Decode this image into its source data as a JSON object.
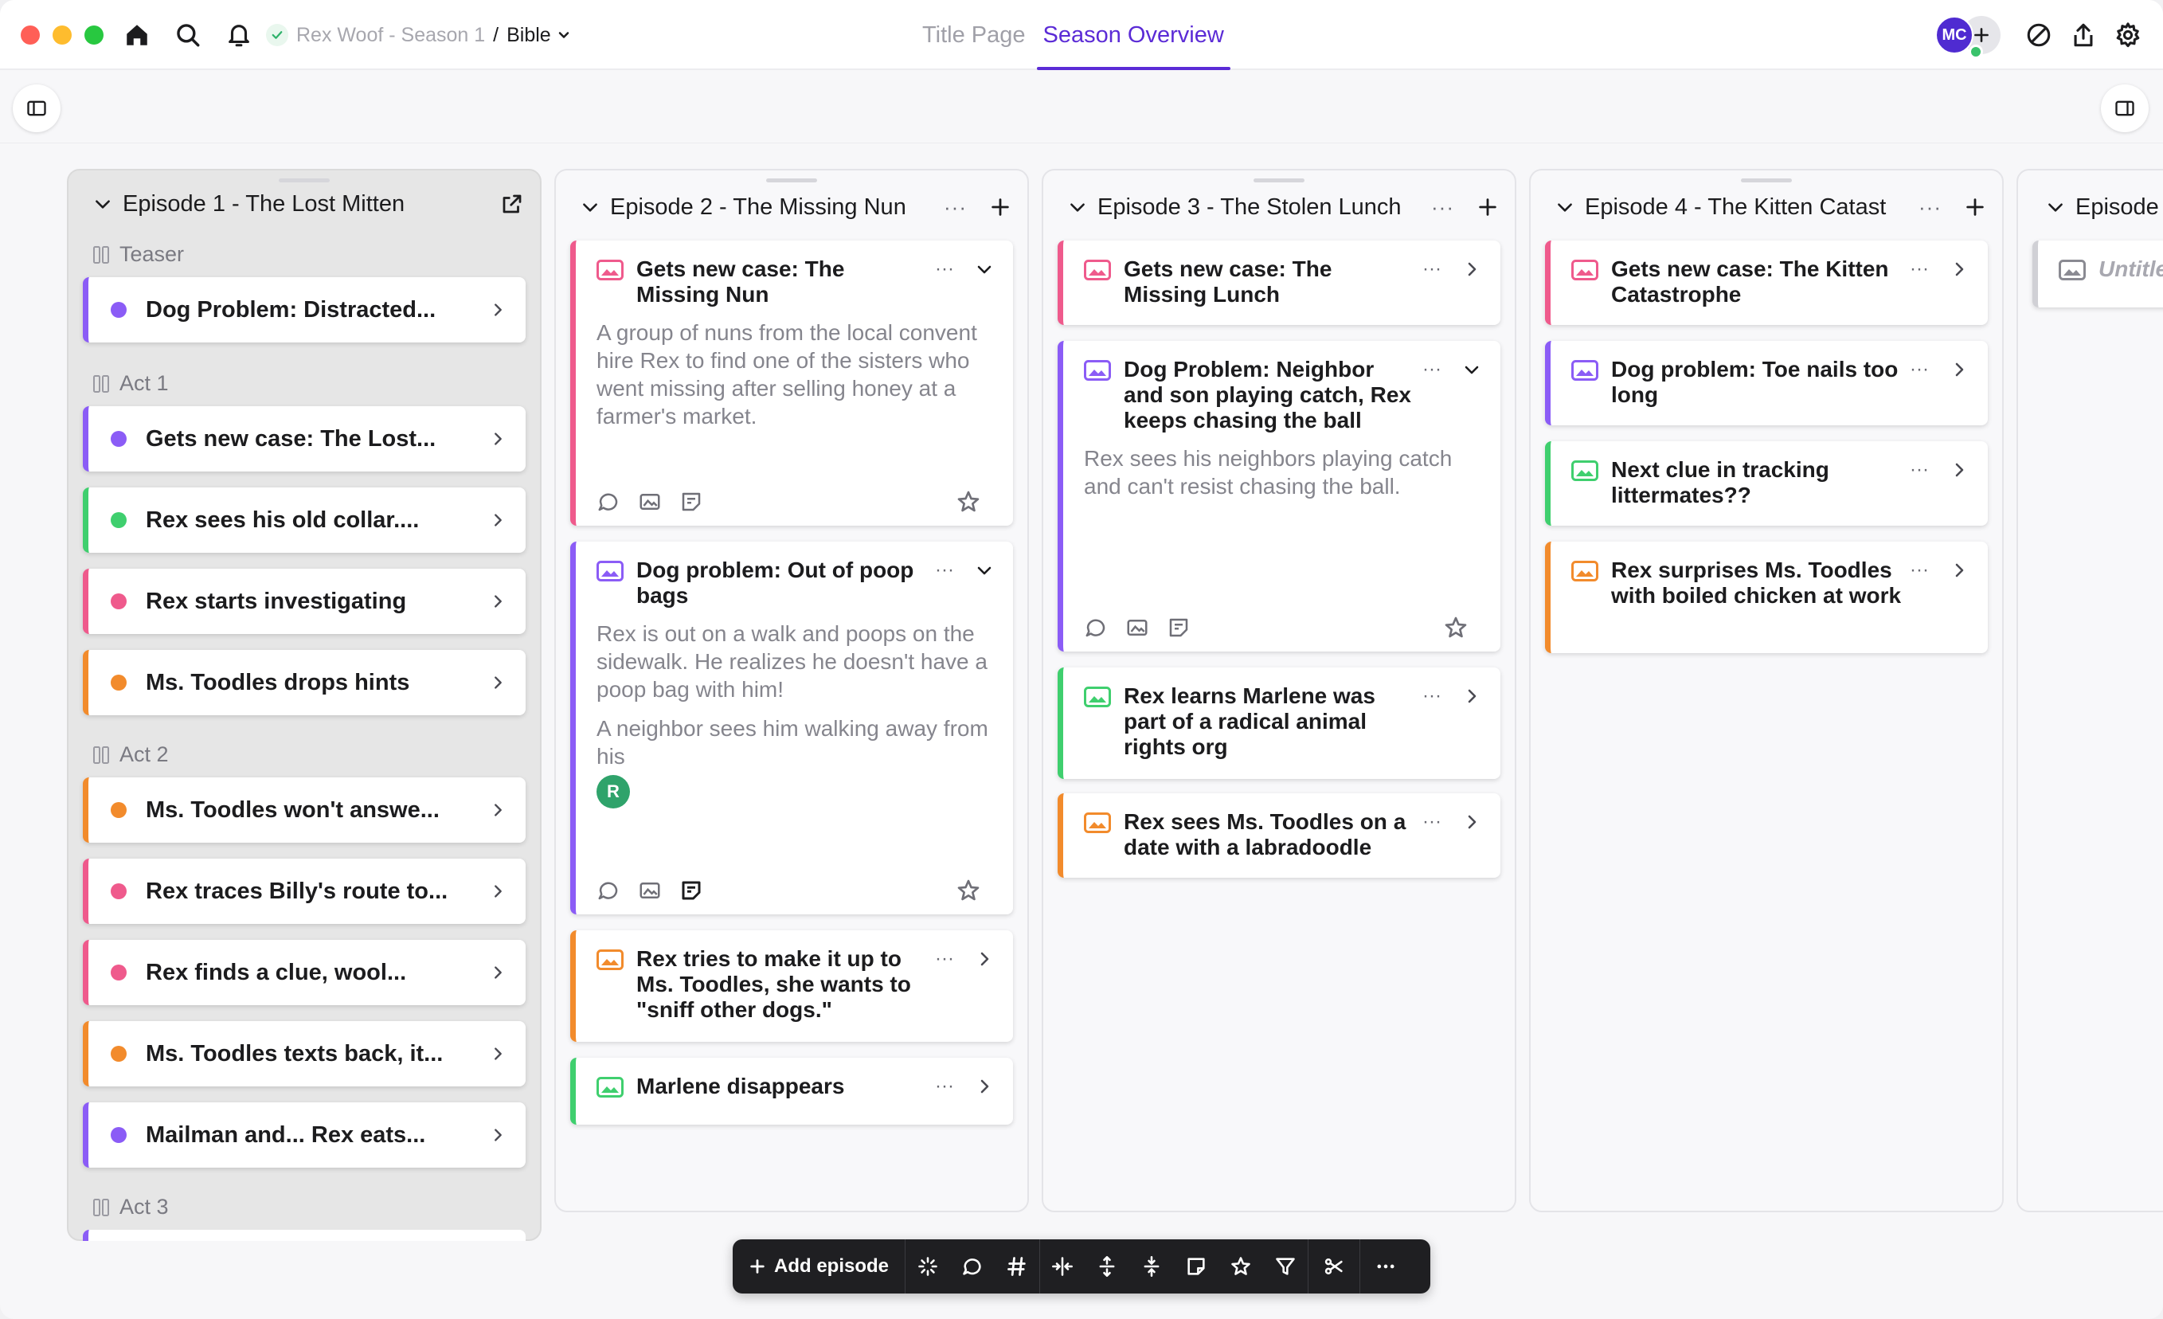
{
  "breadcrumb": {
    "project": "Rex Woof - Season 1",
    "separator": "/",
    "page": "Bible"
  },
  "tabs": [
    {
      "label": "Title Page",
      "active": false
    },
    {
      "label": "Season Overview",
      "active": true
    }
  ],
  "user": {
    "initials": "MC"
  },
  "colors": {
    "accent": "#5b2bd6",
    "purple": "#8b5cf6",
    "green": "#3fcf6e",
    "pink": "#ef5a8c",
    "orange": "#f28b2c"
  },
  "episodes": [
    {
      "title": "Episode 1 - The Lost Mitten",
      "groups": [
        {
          "label": "Teaser",
          "cards": [
            {
              "title": "Dog Problem: Distracted...",
              "color": "purple"
            }
          ]
        },
        {
          "label": "Act 1",
          "cards": [
            {
              "title": "Gets new case: The Lost...",
              "color": "purple"
            },
            {
              "title": "Rex sees his old collar....",
              "color": "green"
            },
            {
              "title": "Rex starts investigating",
              "color": "pink"
            },
            {
              "title": "Ms. Toodles drops hints",
              "color": "orange"
            }
          ]
        },
        {
          "label": "Act 2",
          "cards": [
            {
              "title": "Ms. Toodles won't answe...",
              "color": "orange"
            },
            {
              "title": "Rex traces Billy's route to...",
              "color": "pink"
            },
            {
              "title": "Rex finds a clue, wool...",
              "color": "pink"
            },
            {
              "title": "Ms. Toodles texts back, it...",
              "color": "orange"
            },
            {
              "title": "Mailman and... Rex eats...",
              "color": "purple"
            }
          ]
        },
        {
          "label": "Act 3",
          "cards": []
        }
      ]
    },
    {
      "title": "Episode 2 - The Missing Nun",
      "cards": [
        {
          "title": "Gets new case: The Missing Nun",
          "color": "pink",
          "expanded": true,
          "description": "A group of nuns from the local convent hire Rex to find one of the sisters who went missing after selling honey at a farmer's market."
        },
        {
          "title": "Dog problem: Out of poop bags",
          "color": "purple",
          "expanded": true,
          "description": "Rex is out on a walk and poops on the sidewalk. He realizes he doesn't have a poop bag with him!",
          "description2": "A neighbor sees him walking away from his",
          "avatar": "R"
        },
        {
          "title": "Rex tries to make it up to Ms. Toodles, she wants to \"sniff other dogs.\"",
          "color": "orange"
        },
        {
          "title": "Marlene disappears",
          "color": "green"
        }
      ]
    },
    {
      "title": "Episode 3 - The Stolen Lunch",
      "cards": [
        {
          "title": "Gets new case: The Missing Lunch",
          "color": "pink"
        },
        {
          "title": "Dog Problem: Neighbor and son playing catch, Rex keeps chasing the ball",
          "color": "purple",
          "expanded": true,
          "description": "Rex sees his neighbors playing catch and can't resist chasing the ball."
        },
        {
          "title": "Rex learns Marlene was part of a radical animal rights org",
          "color": "green"
        },
        {
          "title": "Rex sees Ms. Toodles on a date with a labradoodle",
          "color": "orange"
        }
      ]
    },
    {
      "title": "Episode 4 - The Kitten Catast",
      "cards": [
        {
          "title": "Gets new case: The Kitten Catastrophe",
          "color": "pink"
        },
        {
          "title": "Dog problem: Toe nails too long",
          "color": "purple"
        },
        {
          "title": "Next clue in tracking littermates??",
          "color": "green"
        },
        {
          "title": "Rex surprises Ms. Toodles with boiled chicken at work",
          "color": "orange"
        }
      ]
    },
    {
      "title": "Episode",
      "cards": [
        {
          "title": "Untitle",
          "color": "gray"
        }
      ]
    }
  ],
  "toolbar": {
    "add_episode": "Add episode",
    "buttons": [
      "sparkle-icon",
      "comment-icon",
      "hash-icon",
      "collapse-horizontal-icon",
      "expand-vertical-icon",
      "collapse-vertical-icon",
      "note-icon",
      "star-icon",
      "filter-icon",
      "scissors-icon",
      "more-icon"
    ]
  }
}
